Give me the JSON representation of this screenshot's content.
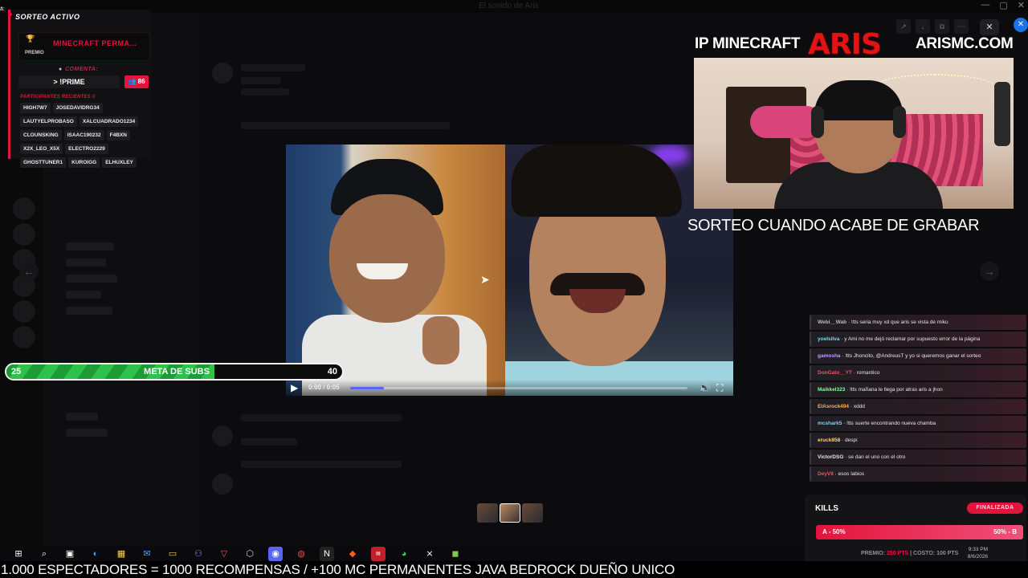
{
  "window": {
    "title": "El sonido de Aris",
    "controls": [
      "—",
      "▢",
      "✕"
    ]
  },
  "giveaway": {
    "title": "SORTEO ACTIVO",
    "prize_label": "PREMIO",
    "prize": "MINECRAFT PERMA...",
    "comment_label": "COMENTA:",
    "command": "> !PRIME",
    "count": "86",
    "recent_label": "PARTICIPANTES RECIENTES //",
    "participants": [
      "HIGH7W7",
      "JOSEDAVIDRG34",
      "LAUTYELPROBASO",
      "XALCUADRADO1234",
      "CLOUNSKING",
      "ISAAC190232",
      "F4BXN",
      "X2X_LEO_X5X",
      "ELECTRO2229",
      "GHOSTTUNER1",
      "KUROIGG",
      "ELHUXLEY"
    ]
  },
  "player": {
    "time": "0:00 / 0:05",
    "progress": 0.1
  },
  "subs_goal": {
    "start": "25",
    "label": "META DE SUBS",
    "end": "40",
    "progress": 0.62
  },
  "header": {
    "ip_label": "IP MINECRAFT",
    "logo": "ARIS",
    "ip_value": "ARISMC.COM"
  },
  "sorteo_note": "SORTEO CUANDO ACABE DE GRABAR",
  "chat": [
    {
      "user": "Webi__Wab",
      "color": "#b9b9bf",
      "msg": "!tts seria muy xd que aris se vista de miku"
    },
    {
      "user": "yoelsilva",
      "color": "#7fd6ff",
      "msg": "y Ami no me dejó reclamar por supuesto error de la página"
    },
    {
      "user": "gamosha",
      "color": "#c49bff",
      "msg": "!tts Jhoncito, @AndreusT y yo si queremos ganar el sorteo"
    },
    {
      "user": "DonGato__YT",
      "color": "#ff4a5c",
      "msg": "romantico"
    },
    {
      "user": "Maikkel323",
      "color": "#7fffa0",
      "msg": "!tts mañana le llega por atras aris a jhon"
    },
    {
      "user": "ElAsrock494",
      "color": "#ffb347",
      "msg": "xddd"
    },
    {
      "user": "mcshark5",
      "color": "#7fd6ff",
      "msg": "!tts suerte encontrando nueva chamba"
    },
    {
      "user": "eruck858",
      "color": "#ffd27f",
      "msg": "despi"
    },
    {
      "user": "VictorDSG",
      "color": "#e6e6e8",
      "msg": "se dan el uno con el otro"
    },
    {
      "user": "DeyV8",
      "color": "#ff4a5c",
      "msg": "esos labios"
    }
  ],
  "kills": {
    "title": "KILLS",
    "status": "FINALIZADA",
    "option_a": "A - 50%",
    "option_b": "50% - B",
    "premio_label": "PREMIO:",
    "premio_value": "250 PTS",
    "costo_label": "| COSTO:",
    "costo_value": "100 PTS"
  },
  "tray": {
    "time": "9:33 PM",
    "date": "8/6/2026"
  },
  "ticker": "1.000 ESPECTADORES = 1000 RECOMPENSAS / +100 MC PERMANENTES JAVA BEDROCK DUEÑO UNICO",
  "colors": {
    "accent": "#e3143c",
    "goal_green": "#2fc24a",
    "logo_red": "#e01414"
  }
}
